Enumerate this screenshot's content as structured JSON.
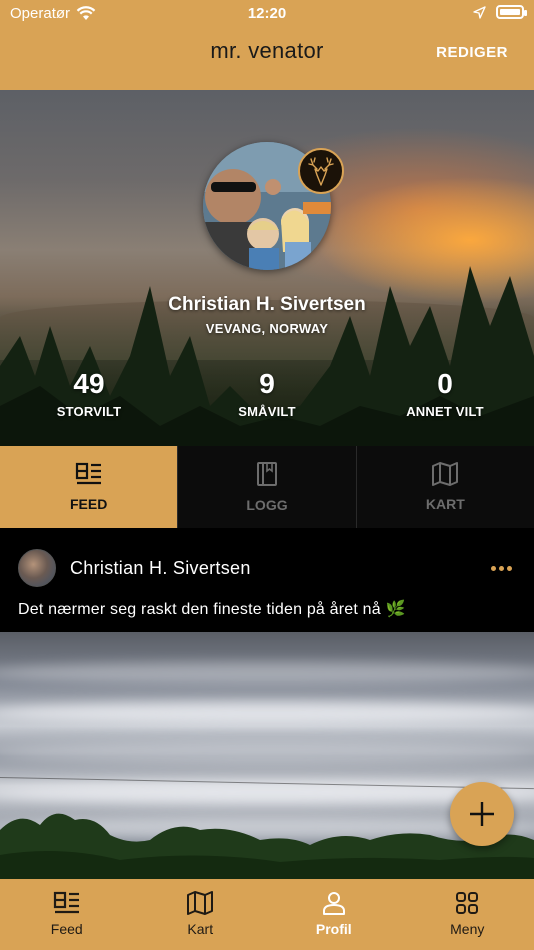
{
  "status_bar": {
    "carrier": "Operatør",
    "time": "12:20"
  },
  "navbar": {
    "title": "mr. venator",
    "edit_label": "REDIGER"
  },
  "profile": {
    "name": "Christian H. Sivertsen",
    "location": "VEVANG, NORWAY",
    "stats": [
      {
        "value": "49",
        "label": "STORVILT"
      },
      {
        "value": "9",
        "label": "SMÅVILT"
      },
      {
        "value": "0",
        "label": "ANNET VILT"
      }
    ]
  },
  "tabs": [
    {
      "label": "FEED",
      "icon": "feed-icon",
      "active": true
    },
    {
      "label": "LOGG",
      "icon": "book-icon",
      "active": false
    },
    {
      "label": "KART",
      "icon": "map-icon",
      "active": false
    }
  ],
  "post": {
    "author": "Christian H. Sivertsen",
    "text": "Det nærmer seg raskt den fineste tiden på året nå 🌿"
  },
  "bottom_nav": [
    {
      "label": "Feed",
      "icon": "feed-icon",
      "active": false
    },
    {
      "label": "Kart",
      "icon": "map-icon",
      "active": false
    },
    {
      "label": "Profil",
      "icon": "person-icon",
      "active": true
    },
    {
      "label": "Meny",
      "icon": "grid-icon",
      "active": false
    }
  ],
  "colors": {
    "accent": "#d9a355",
    "background": "#000000",
    "tab_inactive": "#6d6d6d"
  }
}
